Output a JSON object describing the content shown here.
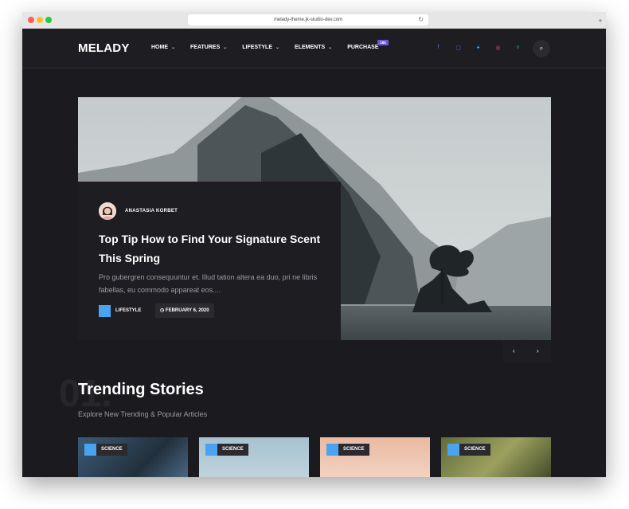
{
  "browser": {
    "url": "melady-theme.jk-studio-dev.com"
  },
  "header": {
    "logo": "MELADY",
    "nav": [
      {
        "label": "HOME"
      },
      {
        "label": "FEATURES"
      },
      {
        "label": "LIFESTYLE"
      },
      {
        "label": "ELEMENTS"
      },
      {
        "label": "PURCHASE",
        "badge": "185"
      }
    ],
    "socials": [
      {
        "icon": "facebook-icon",
        "glyph": "f",
        "color": "#4d6fd6"
      },
      {
        "icon": "twitch-icon",
        "glyph": "▢",
        "color": "#9146ff"
      },
      {
        "icon": "twitter-icon",
        "glyph": "✦",
        "color": "#38a1f3"
      },
      {
        "icon": "dribbble-icon",
        "glyph": "◎",
        "color": "#ea4c89"
      },
      {
        "icon": "vine-icon",
        "glyph": "v",
        "color": "#00b489"
      }
    ],
    "search_icon": "⌕"
  },
  "hero": {
    "author": "ANASTASIA KORBET",
    "title": "Top Tip How to Find Your Signature Scent This Spring",
    "excerpt": "Pro gubergren consequuntur et. Illud tation altera ea duo, pri ne libris fabellas, eu commodo appareat eos....",
    "category": "LIFESTYLE",
    "date": "FEBRUARY 6, 2020",
    "prev": "‹",
    "next": "›"
  },
  "trending": {
    "number": "01.",
    "title": "Trending Stories",
    "subtitle": "Explore New Trending & Popular Articles",
    "cards": [
      {
        "category": "SCIENCE"
      },
      {
        "category": "SCIENCE"
      },
      {
        "category": "SCIENCE"
      },
      {
        "category": "SCIENCE"
      }
    ]
  },
  "colors": {
    "accent": "#4aa3f0",
    "badge": "#6d57d6",
    "background": "#1b1b1f"
  }
}
